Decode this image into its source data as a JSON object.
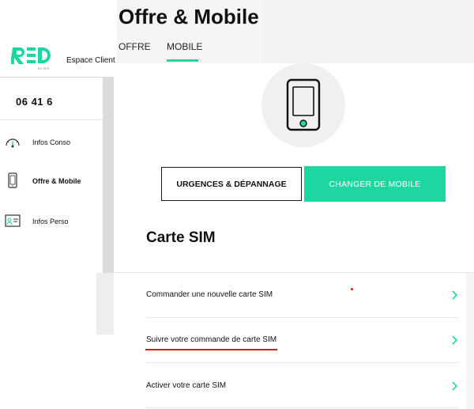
{
  "header": {
    "title": "Offre & Mobile",
    "tabs": [
      {
        "label": "OFFRE"
      },
      {
        "label": "MOBILE"
      }
    ],
    "espace_client": "Espace Client"
  },
  "logo": {
    "text": "RED",
    "subtext": "BY SFR"
  },
  "sidebar": {
    "phone_number": "06 41 6",
    "items": [
      {
        "label": "Infos Conso",
        "icon": "gauge-icon"
      },
      {
        "label": "Offre & Mobile",
        "icon": "mobile-phone-icon"
      },
      {
        "label": "Infos Perso",
        "icon": "id-card-icon"
      }
    ]
  },
  "actions": {
    "urgences": "URGENCES & DÉPANNAGE",
    "changer": "CHANGER DE MOBILE"
  },
  "section": {
    "title": "Carte SIM"
  },
  "sim_options": [
    {
      "label": "Commander une nouvelle carte SIM"
    },
    {
      "label": "Suivre votre commande de carte SIM"
    },
    {
      "label": "Activer votre carte SIM"
    }
  ],
  "colors": {
    "accent": "#1ed7a0",
    "annotation_red": "#d21b1b"
  }
}
